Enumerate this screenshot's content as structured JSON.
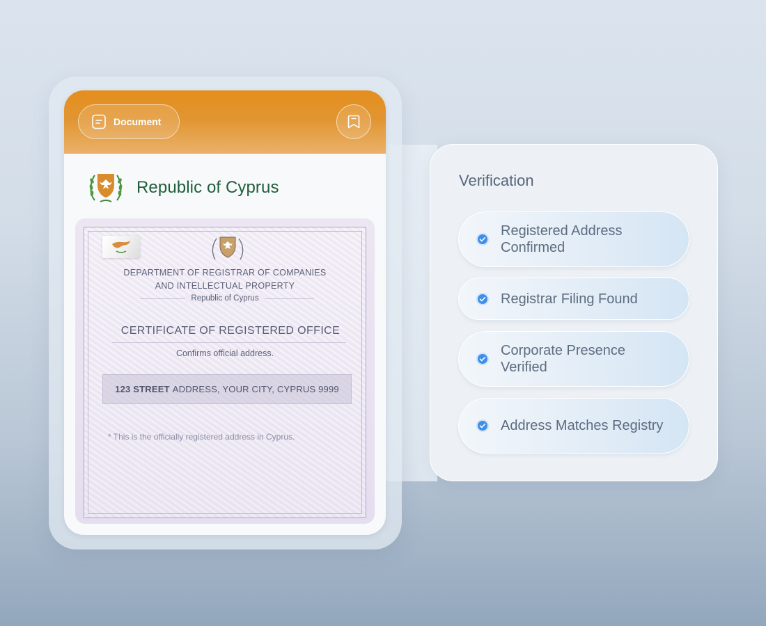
{
  "document_card": {
    "doc_button_label": "Document",
    "bookmark_icon": "bookmark-icon",
    "brand_name": "Republic of Cyprus",
    "accent_color": "#e48e1c",
    "brand_color": "#1e5e3a"
  },
  "certificate": {
    "department_line1": "DEPARTMENT OF REGISTRAR OF COMPANIES",
    "department_line2": "AND INTELLECTUAL PROPERTY",
    "department_sub": "Republic of Cyprus",
    "title": "CERTIFICATE OF REGISTERED OFFICE",
    "subtitle": "Confirms official address.",
    "address_bold": "123 STREET",
    "address_rest": "ADDRESS, YOUR CITY, CYPRUS 9999",
    "footnote": "* This is the officially registered address in Cyprus."
  },
  "verification": {
    "title": "Verification",
    "items": [
      {
        "label": "Registered Address Confirmed"
      },
      {
        "label": "Registrar Filing Found"
      },
      {
        "label": "Corporate Presence Verified"
      },
      {
        "label": "Address Matches Registry"
      }
    ],
    "check_color": "#3d8fe8"
  }
}
